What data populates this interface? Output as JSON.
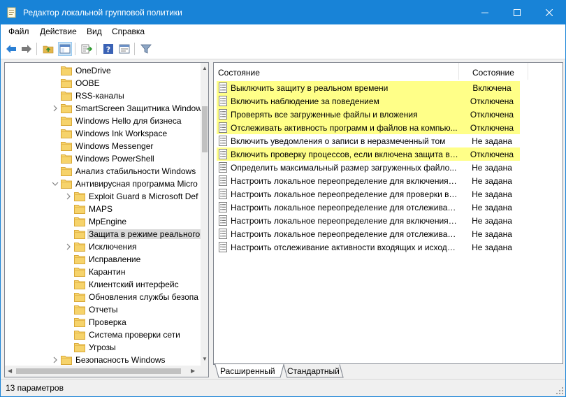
{
  "window": {
    "title": "Редактор локальной групповой политики",
    "accent": "#1883d7"
  },
  "menu": {
    "file": "Файл",
    "action": "Действие",
    "view": "Вид",
    "help": "Справка"
  },
  "toolbar": {
    "icons": [
      "back-arrow-icon",
      "forward-arrow-icon",
      "folder-up-icon",
      "show-tree-icon",
      "export-list-icon",
      "help-icon",
      "properties-icon",
      "filter-icon"
    ]
  },
  "tree": {
    "items": [
      {
        "label": "OneDrive",
        "level": 1,
        "expander": "none"
      },
      {
        "label": "OOBE",
        "level": 1,
        "expander": "none"
      },
      {
        "label": "RSS-каналы",
        "level": 1,
        "expander": "none"
      },
      {
        "label": "SmartScreen Защитника Window",
        "level": 1,
        "expander": "collapsed"
      },
      {
        "label": "Windows Hello для бизнеса",
        "level": 1,
        "expander": "none"
      },
      {
        "label": "Windows Ink Workspace",
        "level": 1,
        "expander": "none"
      },
      {
        "label": "Windows Messenger",
        "level": 1,
        "expander": "none"
      },
      {
        "label": "Windows PowerShell",
        "level": 1,
        "expander": "none"
      },
      {
        "label": "Анализ стабильности Windows",
        "level": 1,
        "expander": "none"
      },
      {
        "label": "Антивирусная программа Micro",
        "level": 1,
        "expander": "expanded"
      },
      {
        "label": "Exploit Guard в Microsoft Def",
        "level": 2,
        "expander": "collapsed"
      },
      {
        "label": "MAPS",
        "level": 2,
        "expander": "none"
      },
      {
        "label": "MpEngine",
        "level": 2,
        "expander": "none"
      },
      {
        "label": "Защита в режиме реального",
        "level": 2,
        "expander": "none",
        "selected": true
      },
      {
        "label": "Исключения",
        "level": 2,
        "expander": "collapsed"
      },
      {
        "label": "Исправление",
        "level": 2,
        "expander": "none"
      },
      {
        "label": "Карантин",
        "level": 2,
        "expander": "none"
      },
      {
        "label": "Клиентский интерфейс",
        "level": 2,
        "expander": "none"
      },
      {
        "label": "Обновления службы безопа",
        "level": 2,
        "expander": "none"
      },
      {
        "label": "Отчеты",
        "level": 2,
        "expander": "none"
      },
      {
        "label": "Проверка",
        "level": 2,
        "expander": "none"
      },
      {
        "label": "Система проверки сети",
        "level": 2,
        "expander": "none"
      },
      {
        "label": "Угрозы",
        "level": 2,
        "expander": "none"
      },
      {
        "label": "Безопасность Windows",
        "level": 1,
        "expander": "collapsed"
      }
    ]
  },
  "list": {
    "headers": {
      "name": "Состояние",
      "state": "Состояние"
    },
    "rows": [
      {
        "name": "Выключить защиту в реальном времени",
        "state": "Включена",
        "highlight": true
      },
      {
        "name": "Включить наблюдение за поведением",
        "state": "Отключена",
        "highlight": true
      },
      {
        "name": "Проверять все загруженные файлы и вложения",
        "state": "Отключена",
        "highlight": true
      },
      {
        "name": "Отслеживать активность программ и файлов на компью...",
        "state": "Отключена",
        "highlight": true
      },
      {
        "name": "Включить уведомления о записи в неразмеченный том",
        "state": "Не задана",
        "highlight": false
      },
      {
        "name": "Включить проверку процессов, если включена защита в ...",
        "state": "Отключена",
        "highlight": true
      },
      {
        "name": "Определить максимальный размер загруженных файло...",
        "state": "Не задана",
        "highlight": false
      },
      {
        "name": "Настроить локальное переопределение для включения к...",
        "state": "Не задана",
        "highlight": false
      },
      {
        "name": "Настроить локальное переопределение для проверки вс...",
        "state": "Не задана",
        "highlight": false
      },
      {
        "name": "Настроить локальное переопределение для отслеживан...",
        "state": "Не задана",
        "highlight": false
      },
      {
        "name": "Настроить локальное переопределение для включения з...",
        "state": "Не задана",
        "highlight": false
      },
      {
        "name": "Настроить локальное переопределение для отслеживан...",
        "state": "Не задана",
        "highlight": false
      },
      {
        "name": "Настроить отслеживание активности входящих и исходя...",
        "state": "Не задана",
        "highlight": false
      }
    ],
    "highlight_color": "#ffff88"
  },
  "tabs": {
    "extended": "Расширенный",
    "standard": "Стандартный"
  },
  "status": {
    "text": "13 параметров"
  }
}
